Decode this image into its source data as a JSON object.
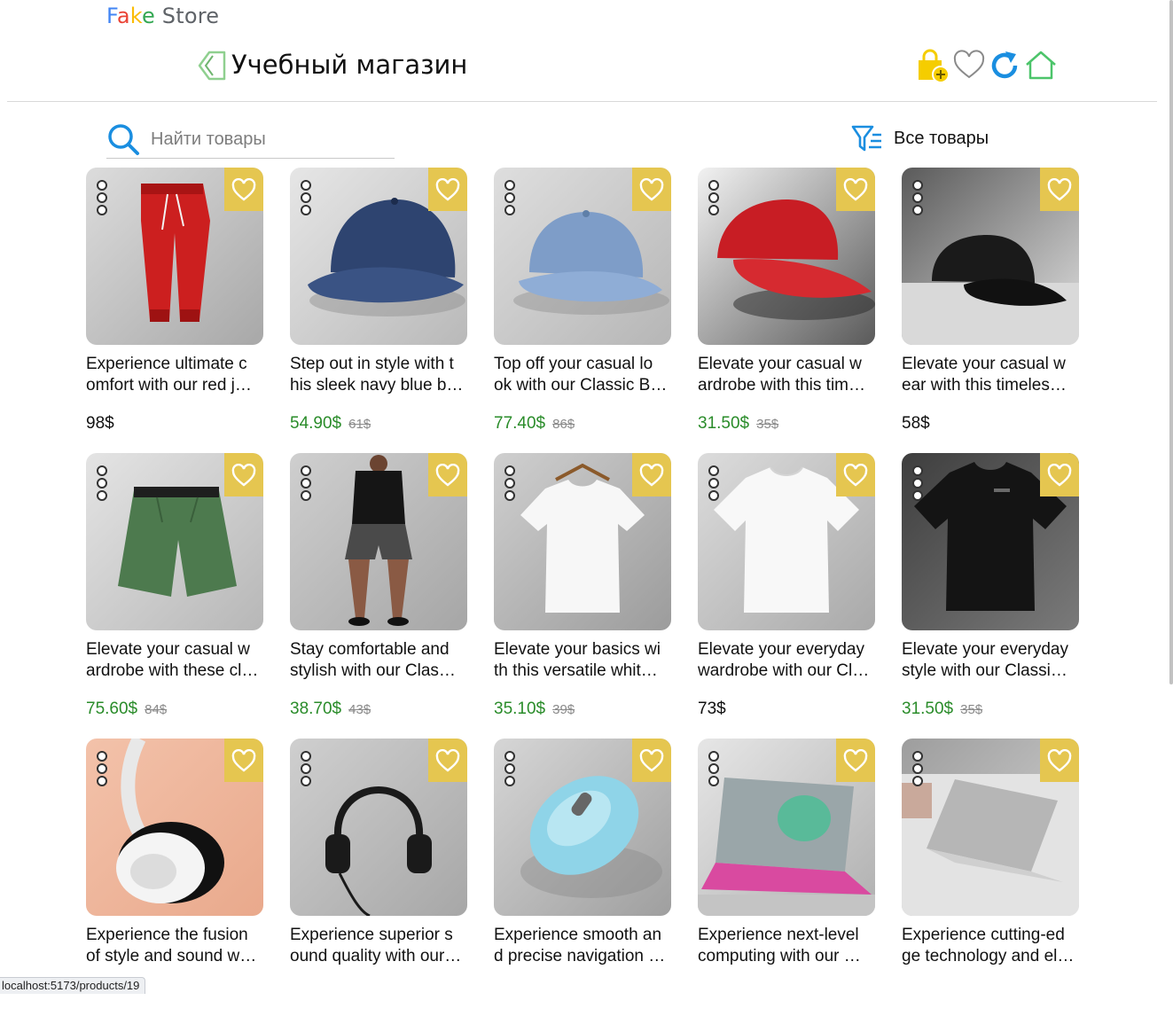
{
  "brand": {
    "letters": [
      "F",
      "a",
      "k",
      "e"
    ],
    "rest": "Store"
  },
  "header": {
    "title": "Учебный магазин",
    "icons": [
      "back-arrow-icon",
      "shopping-bag-add-icon",
      "heart-icon",
      "refresh-icon",
      "home-icon"
    ]
  },
  "search": {
    "placeholder": "Найти товары",
    "value": ""
  },
  "filter": {
    "label": "Все товары",
    "icon": "filter-list-icon"
  },
  "colors": {
    "sale_price": "#2a8c2a",
    "favorite_bg": "#e5c650",
    "bag": "#f5cd00",
    "refresh": "#1a8ee0",
    "home": "#4cc46a"
  },
  "products": [
    {
      "lines": [
        "Experience ultimate c",
        "omfort with our red j…"
      ],
      "price": "98$",
      "old_price": "",
      "image": "red-joggers"
    },
    {
      "lines": [
        "Step out in style with t",
        "his sleek navy blue b…"
      ],
      "price": "54.90$",
      "old_price": "61$",
      "image": "navy-cap"
    },
    {
      "lines": [
        "Top off your casual lo",
        "ok with our Classic B…"
      ],
      "price": "77.40$",
      "old_price": "86$",
      "image": "blue-cap"
    },
    {
      "lines": [
        "Elevate your casual w",
        "ardrobe with this tim…"
      ],
      "price": "31.50$",
      "old_price": "35$",
      "image": "red-cap"
    },
    {
      "lines": [
        "Elevate your casual w",
        "ear with this timeles…"
      ],
      "price": "58$",
      "old_price": "",
      "image": "black-cap"
    },
    {
      "lines": [
        "Elevate your casual w",
        "ardrobe with these cl…"
      ],
      "price": "75.60$",
      "old_price": "84$",
      "image": "green-shorts"
    },
    {
      "lines": [
        "Stay comfortable and",
        "stylish with our Clas…"
      ],
      "price": "38.70$",
      "old_price": "43$",
      "image": "grey-shorts-model"
    },
    {
      "lines": [
        "Elevate your basics wi",
        "th this versatile whit…"
      ],
      "price": "35.10$",
      "old_price": "39$",
      "image": "white-tshirt-hanger"
    },
    {
      "lines": [
        "Elevate your everyday",
        "wardrobe with our Cl…"
      ],
      "price": "73$",
      "old_price": "",
      "image": "white-tshirt"
    },
    {
      "lines": [
        "Elevate your everyday",
        "style with our Classi…"
      ],
      "price": "31.50$",
      "old_price": "35$",
      "image": "black-tshirt"
    },
    {
      "lines": [
        "Experience the fusion",
        "of style and sound w…"
      ],
      "price": "",
      "old_price": "",
      "image": "white-headphones"
    },
    {
      "lines": [
        "Experience superior s",
        "ound quality with our…"
      ],
      "price": "",
      "old_price": "",
      "image": "black-headphones"
    },
    {
      "lines": [
        "Experience smooth an",
        "d precise navigation …"
      ],
      "price": "",
      "old_price": "",
      "image": "blue-mouse"
    },
    {
      "lines": [
        "Experience next-level",
        "computing with our …"
      ],
      "price": "",
      "old_price": "",
      "image": "laptop-neon"
    },
    {
      "lines": [
        "Experience cutting-ed",
        "ge technology and el…"
      ],
      "price": "",
      "old_price": "",
      "image": "laptop-silver"
    }
  ],
  "status_url": "localhost:5173/products/19"
}
